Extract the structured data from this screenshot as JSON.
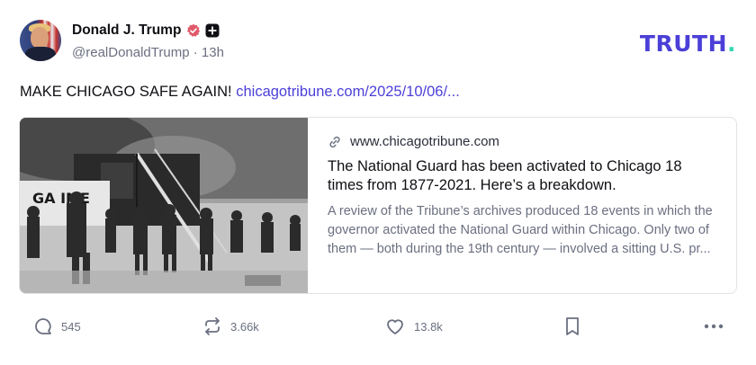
{
  "author": {
    "name": "Donald J. Trump",
    "handle": "@realDonaldTrump",
    "time": "13h",
    "separator": "·"
  },
  "brand": {
    "logo_text": "TRUTH",
    "logo_dot": ".",
    "primary_color": "#4b3fd8",
    "accent_color": "#36d6b3"
  },
  "post": {
    "text": "MAKE CHICAGO SAFE AGAIN!",
    "link_text": "chicagotribune.com/2025/10/06/..."
  },
  "link_card": {
    "domain": "www.chicagotribune.com",
    "title": "The National Guard has been activated to Chicago 18 times from 1877-2021. Here’s a breakdown.",
    "description": "A review of the Tribune’s archives produced 18 events in which the governor activated the National Guard within Chicago. Only two of them — both during the 19th century — involved a sitting U.S. pr...",
    "image_sign_text": "GA  IME"
  },
  "actions": {
    "replies": "545",
    "retruths": "3.66k",
    "likes": "13.8k"
  },
  "icons": {
    "verified": "verified-badge-icon",
    "plus": "plus-badge-icon",
    "link": "link-icon",
    "reply": "reply-icon",
    "retruth": "retruth-icon",
    "like": "heart-icon",
    "bookmark": "bookmark-icon",
    "more": "more-icon"
  }
}
